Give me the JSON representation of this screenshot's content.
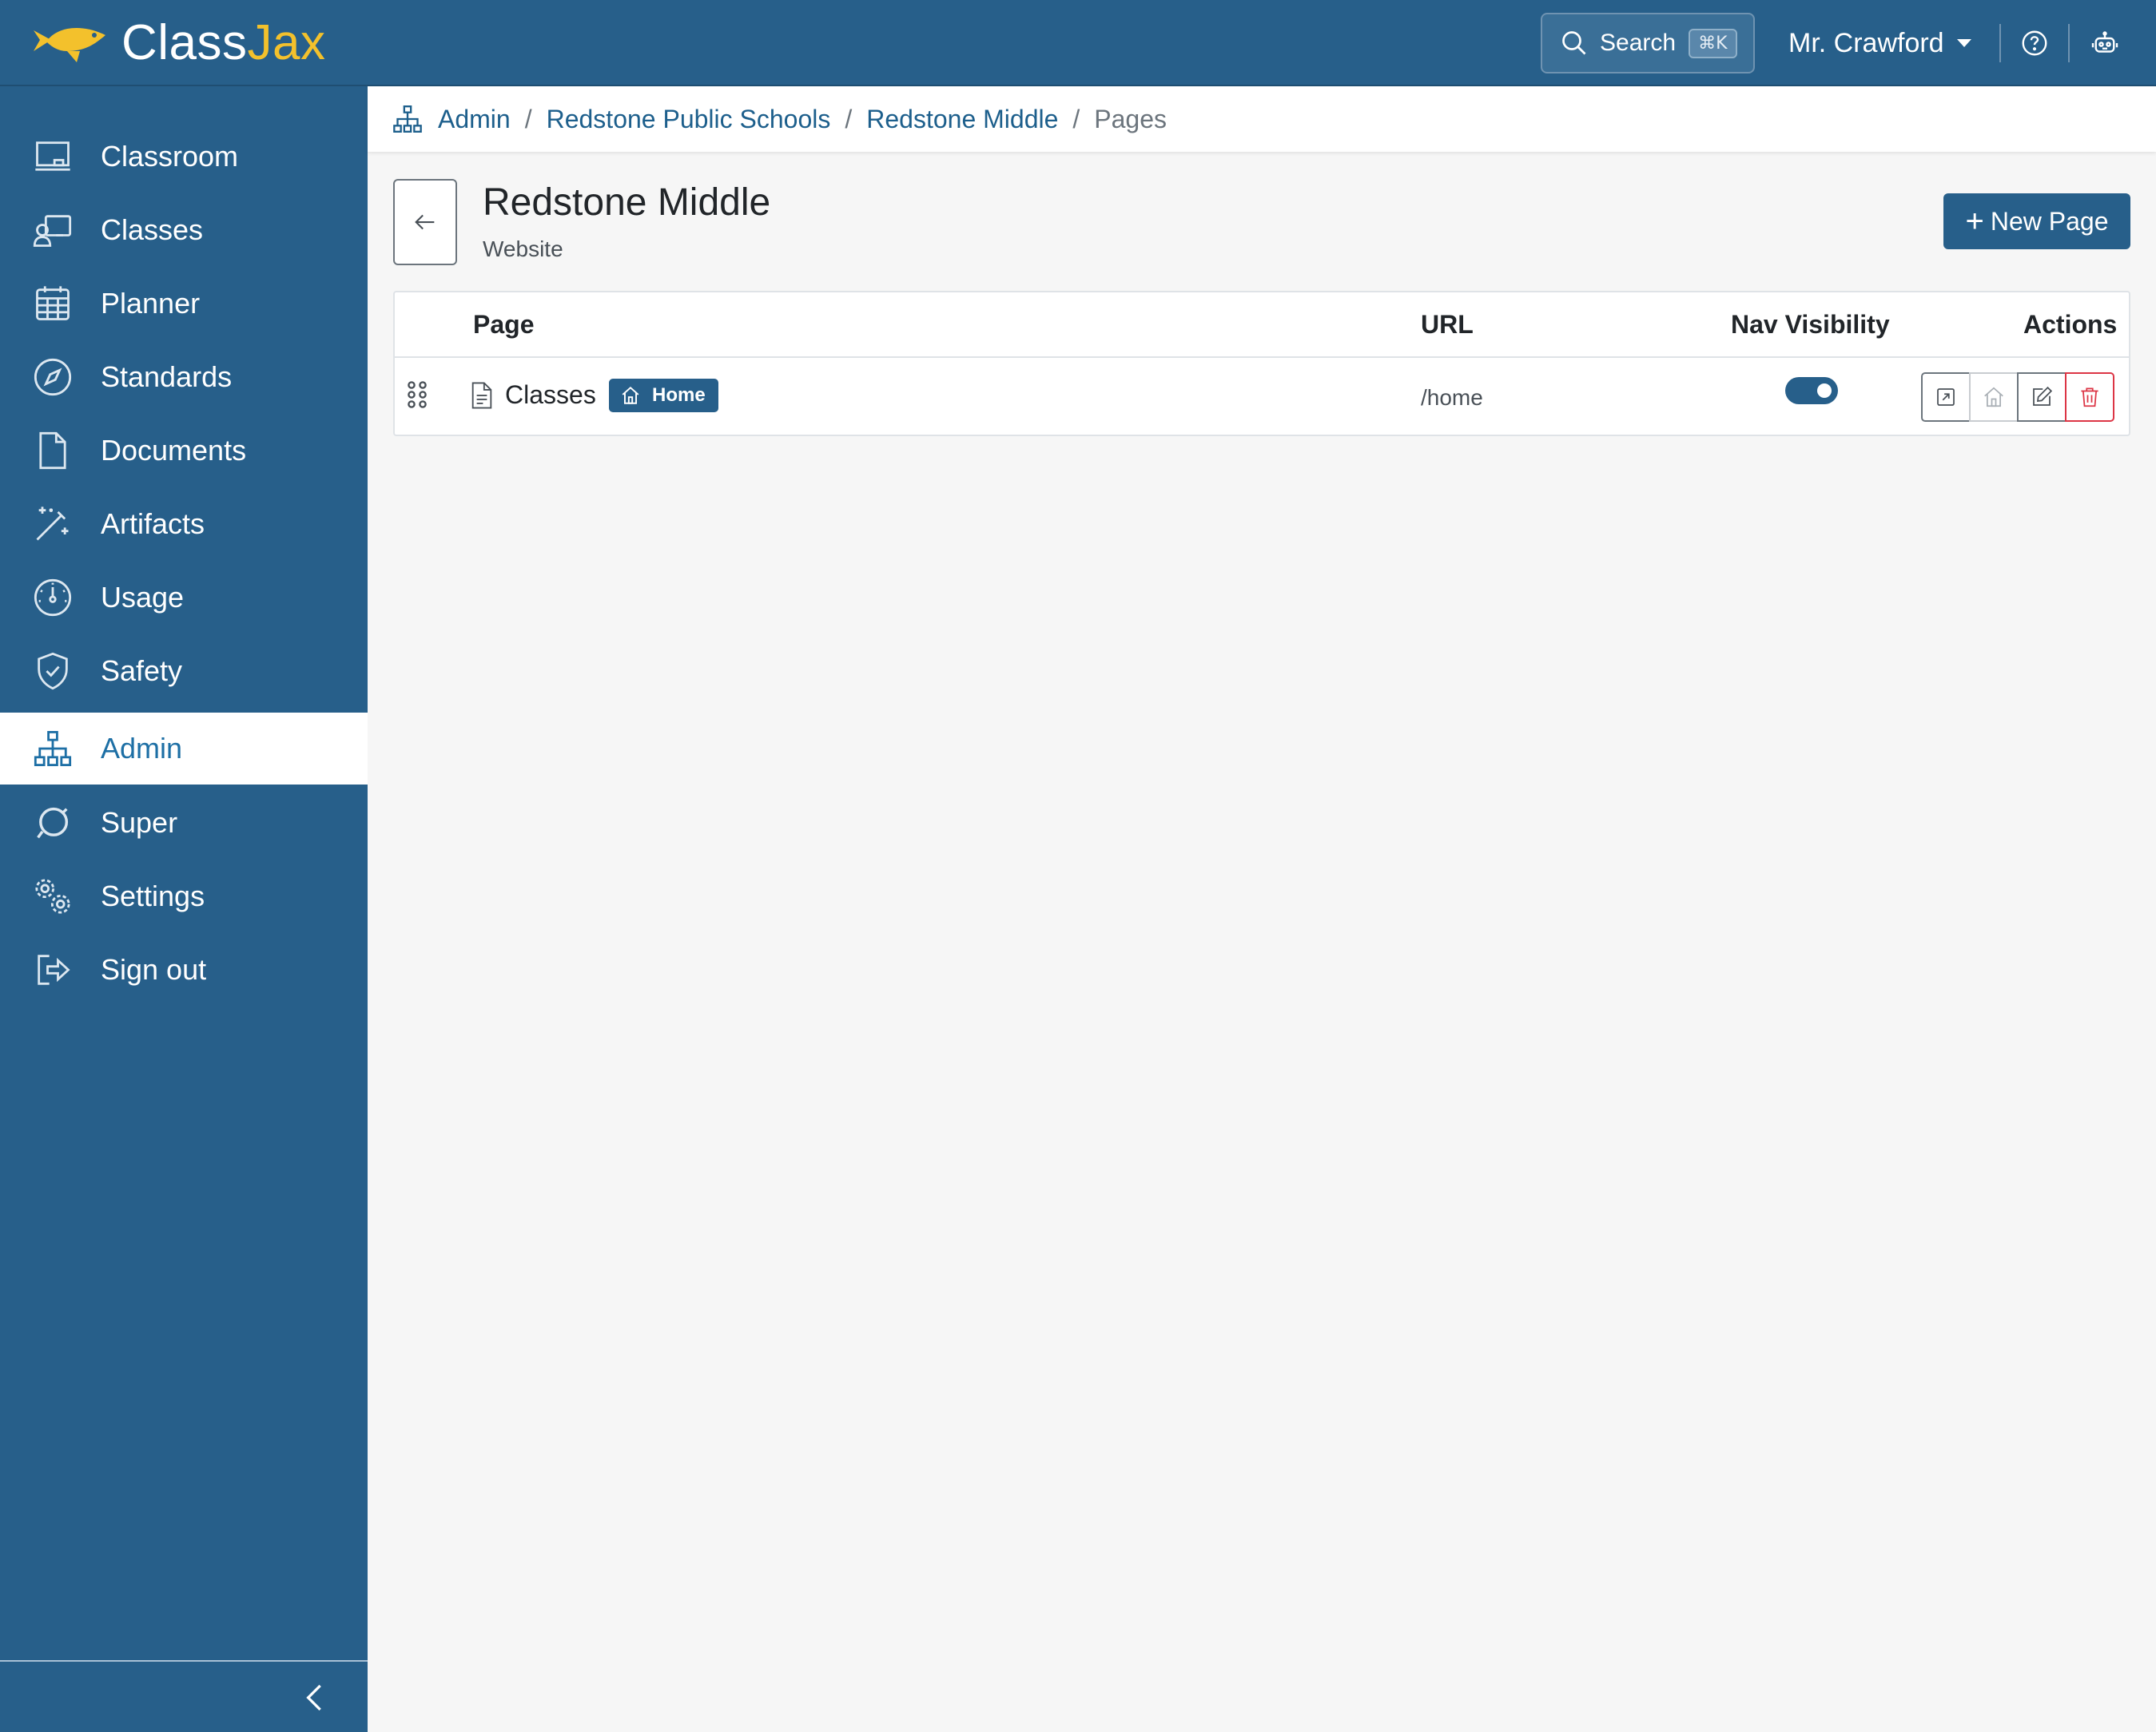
{
  "app": {
    "logo_text_primary": "Class",
    "logo_text_accent": "Jax",
    "brand_color": "#275f8a",
    "accent_color": "#f3c12c"
  },
  "header": {
    "search_label": "Search",
    "search_shortcut": "⌘K",
    "user_name": "Mr. Crawford",
    "help_icon": "question-circle-icon",
    "assistant_icon": "robot-icon"
  },
  "sidebar": {
    "items": [
      {
        "label": "Classroom",
        "icon": "classroom-icon"
      },
      {
        "label": "Classes",
        "icon": "classes-icon"
      },
      {
        "label": "Planner",
        "icon": "calendar-icon"
      },
      {
        "label": "Standards",
        "icon": "compass-icon"
      },
      {
        "label": "Documents",
        "icon": "document-icon"
      },
      {
        "label": "Artifacts",
        "icon": "magic-wand-icon"
      },
      {
        "label": "Usage",
        "icon": "speedometer-icon"
      },
      {
        "label": "Safety",
        "icon": "shield-check-icon"
      },
      {
        "label": "Admin",
        "icon": "org-chart-icon",
        "active": true
      },
      {
        "label": "Super",
        "icon": "super-icon"
      },
      {
        "label": "Settings",
        "icon": "gears-icon"
      },
      {
        "label": "Sign out",
        "icon": "sign-out-icon"
      }
    ],
    "collapse_icon": "chevron-left-icon"
  },
  "breadcrumb": {
    "items": [
      "Admin",
      "Redstone Public Schools",
      "Redstone Middle"
    ],
    "current": "Pages",
    "separator": "/"
  },
  "page": {
    "title": "Redstone Middle",
    "subtitle": "Website",
    "new_page_label": "New Page"
  },
  "table": {
    "columns": [
      "Page",
      "URL",
      "Nav Visibility",
      "Actions"
    ],
    "rows": [
      {
        "name": "Classes",
        "badge": "Home",
        "url": "/home",
        "nav_visible": true
      }
    ]
  }
}
